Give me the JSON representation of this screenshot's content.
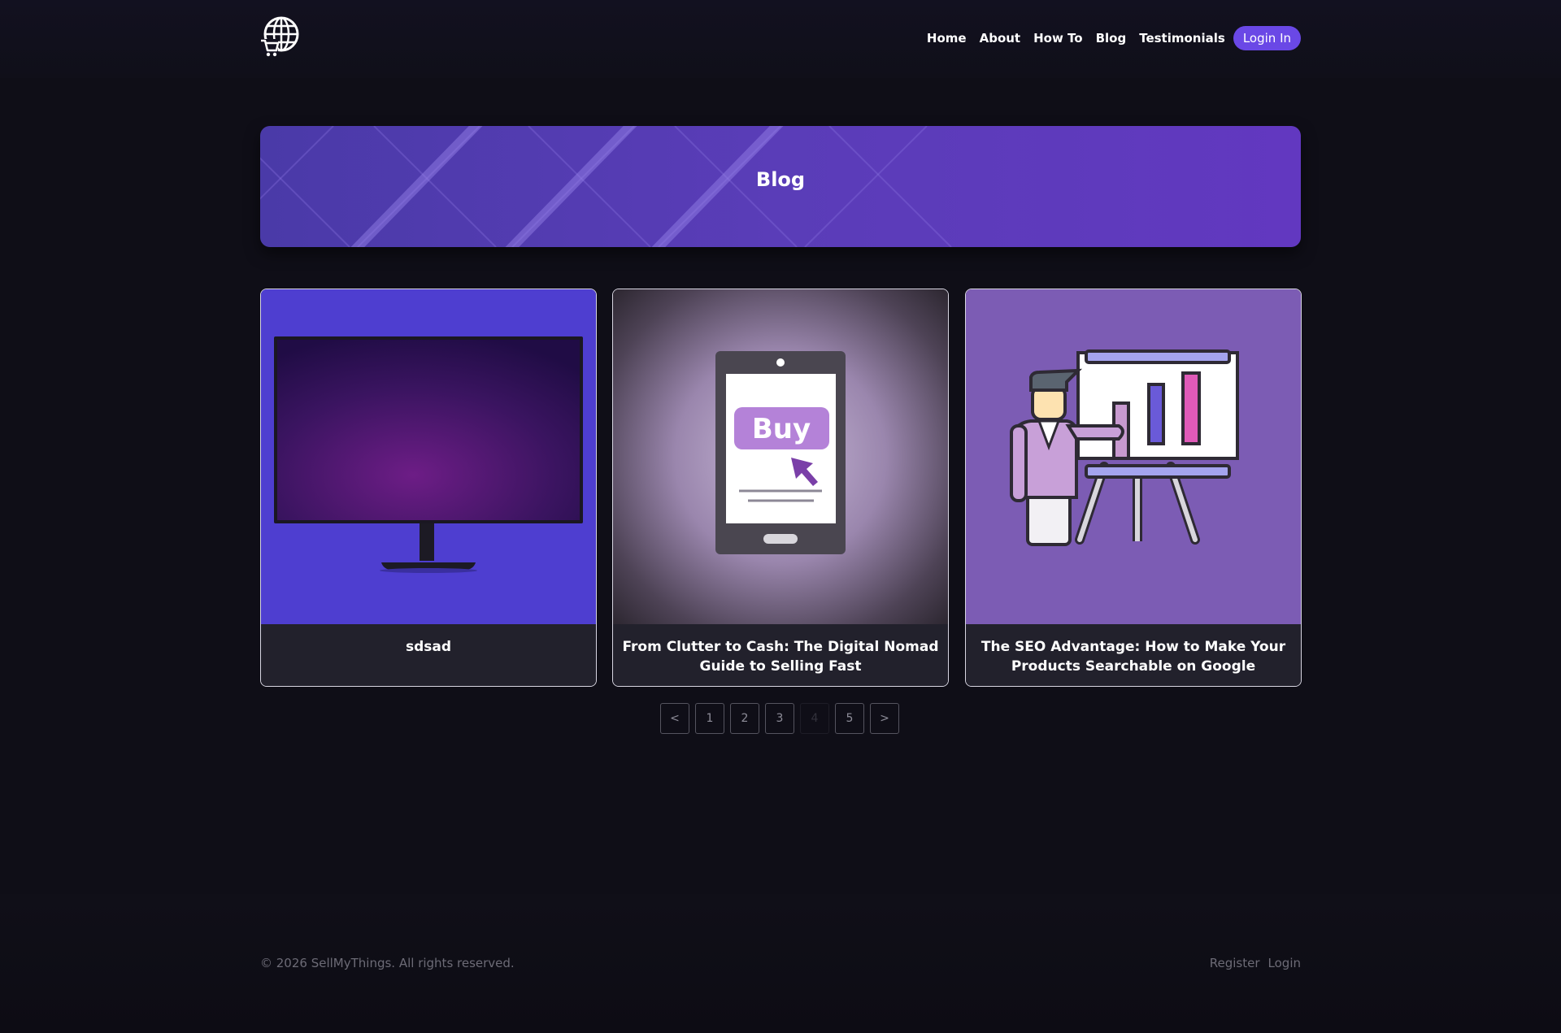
{
  "nav": {
    "items": [
      {
        "label": "Home"
      },
      {
        "label": "About"
      },
      {
        "label": "How To"
      },
      {
        "label": "Blog"
      },
      {
        "label": "Testimonials"
      }
    ],
    "login_label": "Login In"
  },
  "banner": {
    "title": "Blog"
  },
  "posts": [
    {
      "title": "sdsad",
      "image": "monitor-image"
    },
    {
      "title": "From Clutter to Cash: The Digital Nomad Guide to Selling Fast",
      "image": "phone-buy-image"
    },
    {
      "title": "The SEO Advantage: How to Make Your Products Searchable on Google",
      "image": "presentation-chart-image"
    }
  ],
  "pagination": {
    "prev": "<",
    "pages": [
      "1",
      "2",
      "3",
      "4",
      "5"
    ],
    "active": "4",
    "next": ">"
  },
  "footer": {
    "copyright": "© 2026 SellMyThings. All rights reserved.",
    "links": [
      "Register",
      "Login"
    ]
  },
  "colors": {
    "background": "#0f0e17",
    "accent": "#6a48e6",
    "banner": "#5a3db8",
    "card_caption": "#22212c"
  }
}
